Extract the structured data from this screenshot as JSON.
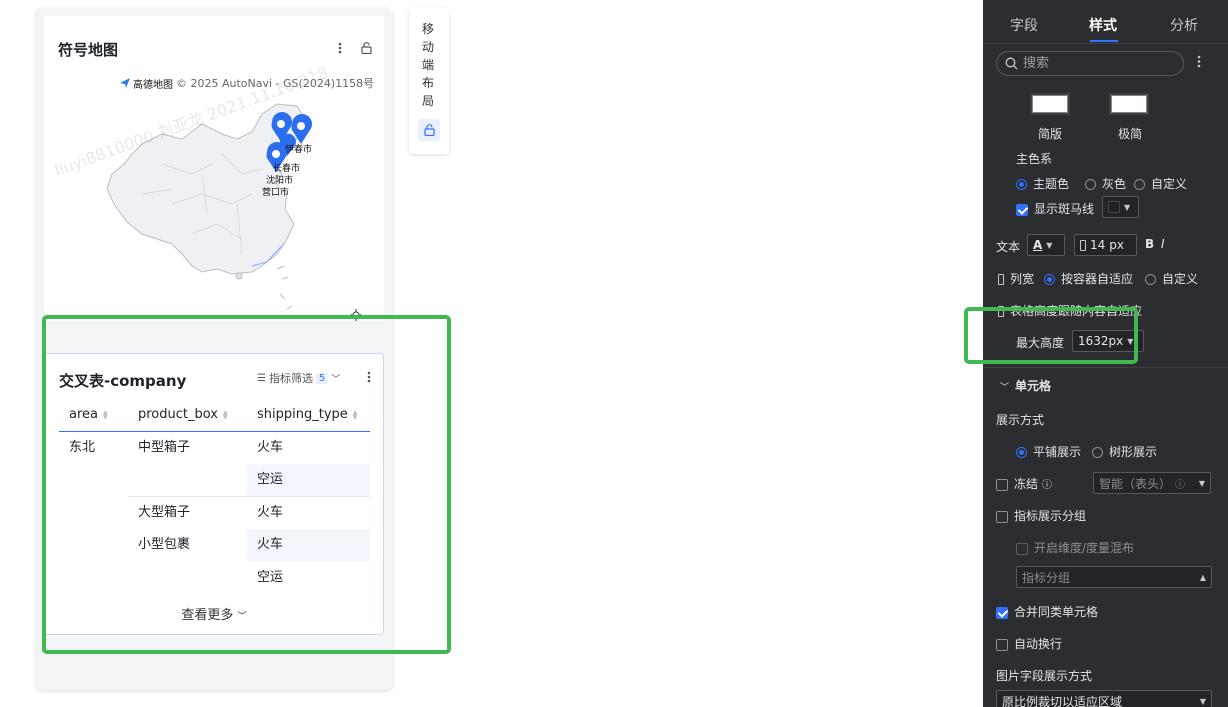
{
  "map_card": {
    "title": "符号地图",
    "attribution": "© 2025 AutoNavi - GS(2024)1158号",
    "brand": "高德地图",
    "city_labels": [
      "伊春市",
      "长春市",
      "沈阳市",
      "营口市"
    ]
  },
  "watermark": "liuyi8810000 刘亚龙 2021.11.16.218",
  "table_card": {
    "title": "交叉表-company",
    "filter_label": "指标筛选",
    "filter_count": "5",
    "columns": [
      "area",
      "product_box",
      "shipping_type"
    ],
    "rows": [
      {
        "area": "东北",
        "product_box": "中型箱子",
        "shipping_type": "火车"
      },
      {
        "area": "",
        "product_box": "",
        "shipping_type": "空运"
      },
      {
        "area": "",
        "product_box": "大型箱子",
        "shipping_type": "火车"
      },
      {
        "area": "",
        "product_box": "小型包裹",
        "shipping_type": "火车"
      },
      {
        "area": "",
        "product_box": "",
        "shipping_type": "空运"
      }
    ],
    "see_more": "查看更多"
  },
  "mobile_layout_label": "移动端布局",
  "panel": {
    "tabs": [
      "字段",
      "样式",
      "分析"
    ],
    "active_tab": "样式",
    "search_placeholder": "搜索",
    "style_options": [
      "简版",
      "极简"
    ],
    "color_scheme_label": "主色系",
    "color_options": [
      "主题色",
      "灰色",
      "自定义"
    ],
    "zebra_label": "显示斑马线",
    "text_label": "文本",
    "font_size": "14",
    "font_unit": "px",
    "col_width_label": "列宽",
    "col_width_options": [
      "按容器自适应",
      "自定义"
    ],
    "height_auto_label": "表格高度跟随内容自适应",
    "max_height_label": "最大高度",
    "max_height_value": "1632px",
    "cell_section": "单元格",
    "display_mode_label": "展示方式",
    "display_options": [
      "平铺展示",
      "树形展示"
    ],
    "freeze_label": "冻结",
    "freeze_value": "智能（表头）",
    "metric_group_label": "指标展示分组",
    "dim_mix_label": "开启维度/度量混布",
    "metric_group_placeholder": "指标分组",
    "merge_cells_label": "合并同类单元格",
    "wrap_label": "自动换行",
    "image_mode_label": "图片字段展示方式",
    "image_mode_value": "原比例裁切以适应区域"
  },
  "colors": {
    "accent": "#3370ff",
    "highlight": "#3fb950",
    "panel_bg": "#2b2d31"
  }
}
